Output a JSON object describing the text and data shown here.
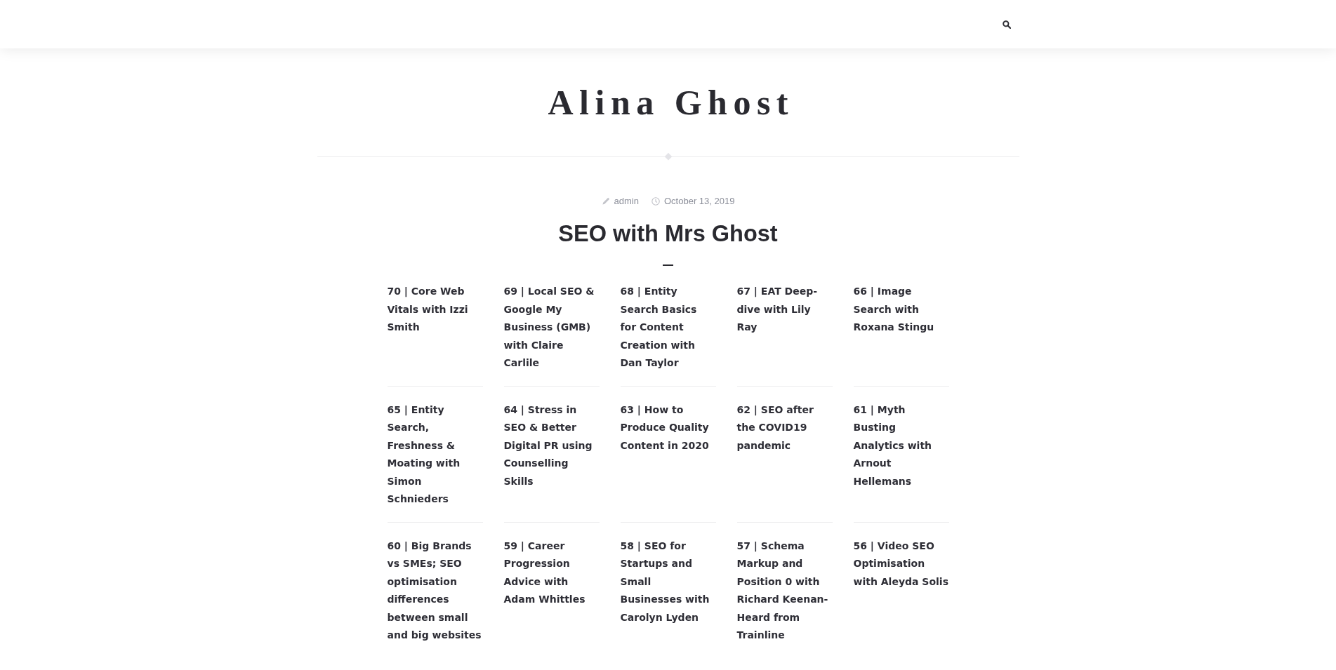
{
  "site_title": "Alina Ghost",
  "post": {
    "author": "admin",
    "date": "October 13, 2019",
    "title": "SEO with Mrs Ghost",
    "episodes": [
      "70 | Core Web Vitals with Izzi Smith",
      "69 | Local SEO & Google My Business (GMB) with Claire Carlile",
      "68 | Entity Search Basics for Content Creation with Dan Taylor",
      "67 | EAT Deep-dive with Lily Ray",
      "66 | Image Search with Roxana Stingu",
      "65 | Entity Search, Freshness & Moating with Simon Schnieders",
      "64 | Stress in SEO & Better Digital PR using Counselling Skills",
      "63 | How to Produce Quality Content in 2020",
      "62 | SEO after the COVID19 pandemic",
      "61 | Myth Busting Analytics with Arnout Hellemans",
      "60 | Big Brands vs SMEs; SEO optimisation differences between small and big websites",
      "59 | Career Progression Advice with Adam Whittles",
      "58 | SEO for Startups and Small Businesses with Carolyn Lyden",
      "57 | Schema Markup and Position 0 with Richard Keenan-Heard from Trainline",
      "56 | Video SEO Optimisation with Aleyda Solis"
    ]
  }
}
